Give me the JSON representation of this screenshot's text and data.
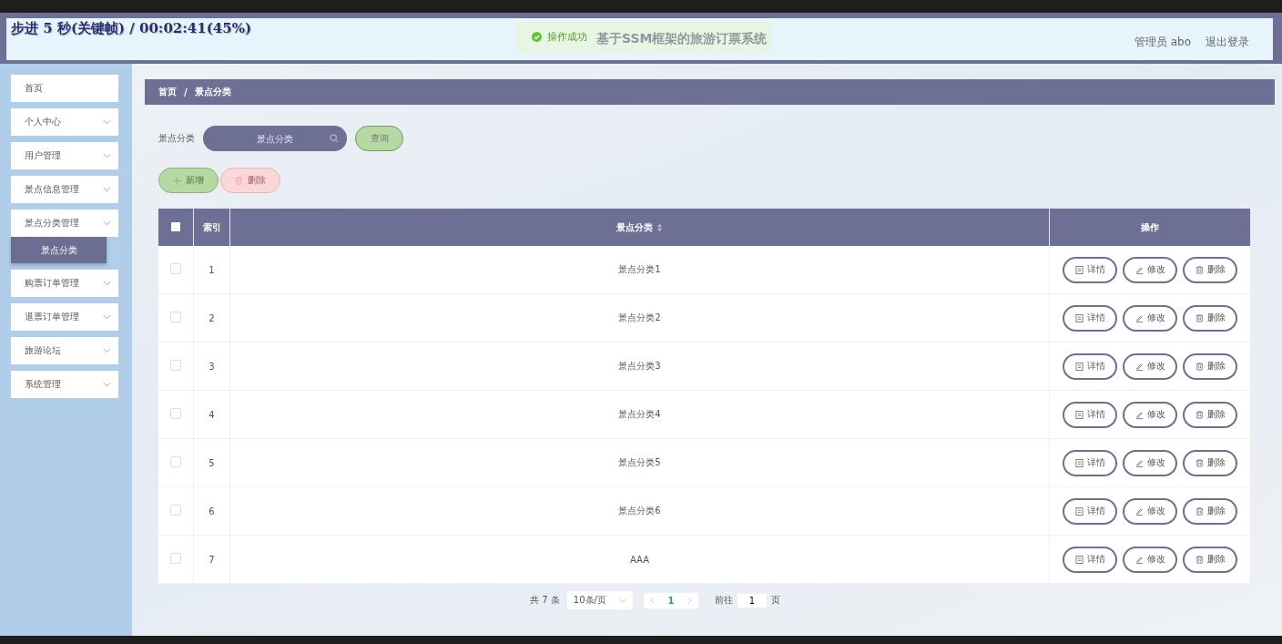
{
  "player_overlay": "步进 5 秒(关键帧) / 00:02:41(45%)",
  "header": {
    "title": "基于SSM框架的旅游订票系统",
    "toast": "操作成功",
    "user": "管理员 abo",
    "logout": "退出登录"
  },
  "sidebar": {
    "items": [
      {
        "label": "首页",
        "kind": "link"
      },
      {
        "label": "个人中心",
        "kind": "submenu"
      },
      {
        "label": "用户管理",
        "kind": "submenu"
      },
      {
        "label": "景点信息管理",
        "kind": "submenu"
      },
      {
        "label": "景点分类管理",
        "kind": "submenu",
        "children": [
          {
            "label": "景点分类",
            "selected": true
          }
        ]
      },
      {
        "label": "购票订单管理",
        "kind": "submenu"
      },
      {
        "label": "退票订单管理",
        "kind": "submenu"
      },
      {
        "label": "旅游论坛",
        "kind": "submenu"
      },
      {
        "label": "系统管理",
        "kind": "submenu"
      }
    ]
  },
  "breadcrumb": [
    "首页",
    "景点分类"
  ],
  "breadcrumb_separator": "/",
  "search": {
    "label": "景点分类",
    "placeholder": "景点分类",
    "button": "查询"
  },
  "actions": [
    {
      "label": "新增",
      "kind": "add"
    },
    {
      "label": "删除",
      "kind": "delete"
    }
  ],
  "table": {
    "header_checked": false,
    "columns": [
      "索引",
      "景点分类",
      "操作"
    ],
    "rows": [
      {
        "checked": false,
        "index": "1",
        "name": "景点分类1",
        "actions": [
          "详情",
          "修改",
          "删除"
        ]
      },
      {
        "checked": false,
        "index": "2",
        "name": "景点分类2",
        "actions": [
          "详情",
          "修改",
          "删除"
        ]
      },
      {
        "checked": false,
        "index": "3",
        "name": "景点分类3",
        "actions": [
          "详情",
          "修改",
          "删除"
        ]
      },
      {
        "checked": false,
        "index": "4",
        "name": "景点分类4",
        "actions": [
          "详情",
          "修改",
          "删除"
        ]
      },
      {
        "checked": false,
        "index": "5",
        "name": "景点分类5",
        "actions": [
          "详情",
          "修改",
          "删除"
        ]
      },
      {
        "checked": false,
        "index": "6",
        "name": "景点分类6",
        "actions": [
          "详情",
          "修改",
          "删除"
        ]
      },
      {
        "checked": false,
        "index": "7",
        "name": "AAA",
        "actions": [
          "详情",
          "修改",
          "删除"
        ]
      }
    ]
  },
  "pagination": {
    "total": "共 7 条",
    "page_size": "10条/页",
    "pages": [
      {
        "label": "1",
        "selected": true
      }
    ],
    "goto": "前往",
    "goto_value": "1",
    "page_unit": "页"
  }
}
